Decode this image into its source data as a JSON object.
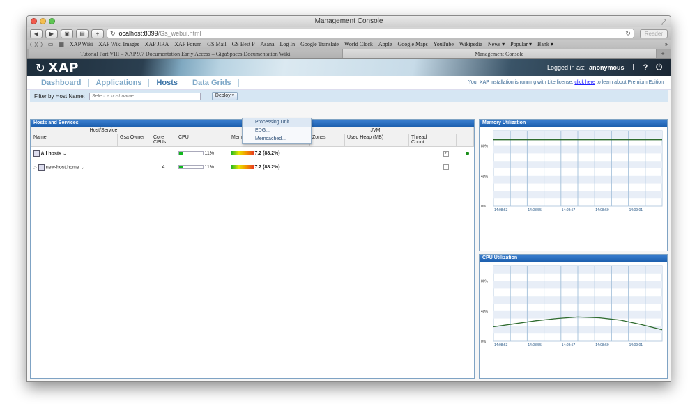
{
  "browser": {
    "window_title": "Management Console",
    "address_host": "localhost:8099",
    "address_path": "/Gs_webui.html",
    "reader": "Reader",
    "bookmarks": [
      "XAP Wiki",
      "XAP Wiki Images",
      "XAP JIRA",
      "XAP Forum",
      "GS Mail",
      "GS Best P",
      "Asana – Log In",
      "Google Translate",
      "World Clock",
      "Apple",
      "Google Maps",
      "YouTube",
      "Wikipedia",
      "News ▾",
      "Popular ▾",
      "Bank ▾"
    ],
    "tabs": [
      "Tutorial Part VIII – XAP 9.7 Documentation Early Access – GigaSpaces Documentation Wiki",
      "Management Console"
    ]
  },
  "header": {
    "logo": "XAP",
    "logged_in_label": "Logged in as:",
    "user": "anonymous",
    "info": "i",
    "help": "?",
    "power": "⏻"
  },
  "nav": {
    "items": [
      "Dashboard",
      "Applications",
      "Hosts",
      "Data Grids"
    ],
    "license_pre": "Your XAP installation is running with Lite license,",
    "license_link": "click here",
    "license_post": "to learn about Premium Edition"
  },
  "filter": {
    "label": "Filter by Host Name:",
    "placeholder": "Select a host name...",
    "deploy": "Deploy ▾"
  },
  "deploy_menu": [
    "Processing Unit...",
    "EDG...",
    "Memcached..."
  ],
  "hosts": {
    "title": "Hosts and Services",
    "group_host": "Host/Service",
    "group_jvm": "JVM",
    "columns": [
      "Name",
      "Gsa Owner",
      "Core CPUs",
      "CPU",
      "Memory",
      "PID",
      "Zones",
      "Used Heap (MB)",
      "Thread Count"
    ],
    "rows": [
      {
        "name": "All hosts",
        "cores": "",
        "cpu": "11%",
        "cpu_frac": 0.2,
        "mem": "7.2 (88.2%)",
        "checked": "✓"
      },
      {
        "name": "new-host.home",
        "cores": "4",
        "cpu": "11%",
        "cpu_frac": 0.2,
        "mem": "7.2 (88.2%)",
        "checked": ""
      }
    ]
  },
  "memory_chart": {
    "title": "Memory Utilization",
    "chart_data": {
      "type": "line",
      "x": [
        "14:08:53",
        "14:08:55",
        "14:08:57",
        "14:08:59",
        "14:09:01"
      ],
      "series": [
        {
          "values": [
            88.2,
            88.2,
            88.2,
            88.2,
            88.2
          ]
        }
      ],
      "yticks": [
        "0%",
        "40%",
        "80%"
      ],
      "ylim": [
        0,
        100
      ],
      "color": "#2e6b2e"
    }
  },
  "cpu_chart": {
    "title": "CPU Utilization",
    "chart_data": {
      "type": "line",
      "x": [
        "14:08:53",
        "14:08:55",
        "14:08:57",
        "14:08:59",
        "14:09:01"
      ],
      "series": [
        {
          "values": [
            19,
            23,
            27,
            30,
            32,
            31,
            28,
            22,
            15
          ]
        }
      ],
      "yticks": [
        "0%",
        "40%",
        "80%"
      ],
      "ylim": [
        0,
        100
      ],
      "color": "#2e6b2e"
    }
  }
}
